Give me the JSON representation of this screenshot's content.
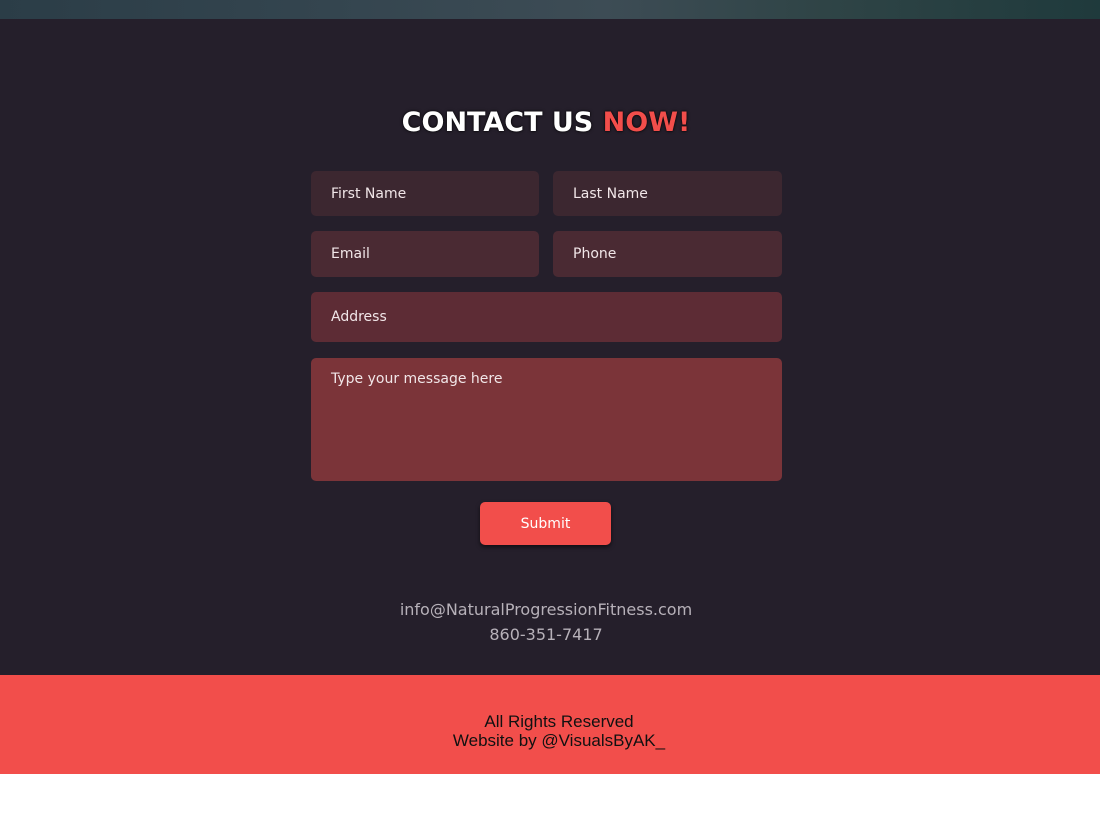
{
  "contact": {
    "heading_main": "CONTACT US",
    "heading_accent": "NOW!",
    "form": {
      "first_name_placeholder": "First Name",
      "last_name_placeholder": "Last Name",
      "email_placeholder": "Email",
      "phone_placeholder": "Phone",
      "address_placeholder": "Address",
      "message_placeholder": "Type your message here",
      "submit_label": "Submit"
    },
    "email": "info@NaturalProgressionFitness.com",
    "phone": "860-351-7417"
  },
  "footer": {
    "rights": "All Rights Reserved",
    "credit": "Website by @VisualsByAK_"
  },
  "colors": {
    "accent": "#f24e4b",
    "section_background": "#251f2b"
  }
}
